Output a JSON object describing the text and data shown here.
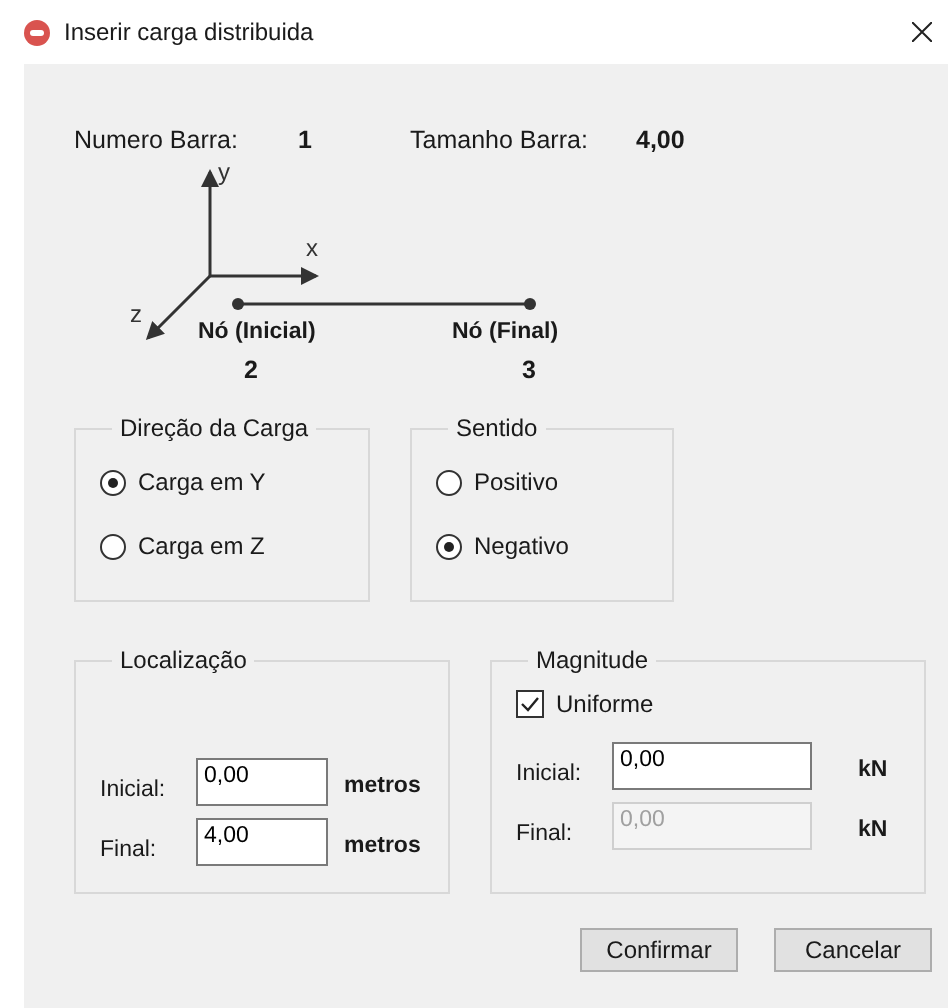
{
  "window": {
    "title": "Inserir carga distribuida"
  },
  "bar": {
    "number_label": "Numero Barra:",
    "number": "1",
    "length_label": "Tamanho Barra:",
    "length": "4,00"
  },
  "axes": {
    "y": "y",
    "x": "x",
    "z": "z"
  },
  "nodes": [
    {
      "label": "Nó (Inicial)",
      "number": "2"
    },
    {
      "label": "Nó (Final)",
      "number": "3"
    }
  ],
  "direction": {
    "title": "Direção da Carga",
    "options": [
      {
        "label": "Carga em Y",
        "selected": true
      },
      {
        "label": "Carga em Z",
        "selected": false
      }
    ]
  },
  "sense": {
    "title": "Sentido",
    "options": [
      {
        "label": "Positivo",
        "selected": false
      },
      {
        "label": "Negativo",
        "selected": true
      }
    ]
  },
  "location": {
    "title": "Localização",
    "fields": [
      {
        "label": "Inicial:",
        "value": "0,00",
        "unit": "metros",
        "disabled": false
      },
      {
        "label": "Final:",
        "value": "4,00",
        "unit": "metros",
        "disabled": false
      }
    ]
  },
  "magnitude": {
    "title": "Magnitude",
    "uniform": {
      "label": "Uniforme",
      "checked": true
    },
    "fields": [
      {
        "label": "Inicial:",
        "value": "0,00",
        "unit": "kN",
        "disabled": false
      },
      {
        "label": "Final:",
        "value": "0,00",
        "unit": "kN",
        "disabled": true
      }
    ]
  },
  "buttons": [
    "Confirmar",
    "Cancelar"
  ]
}
